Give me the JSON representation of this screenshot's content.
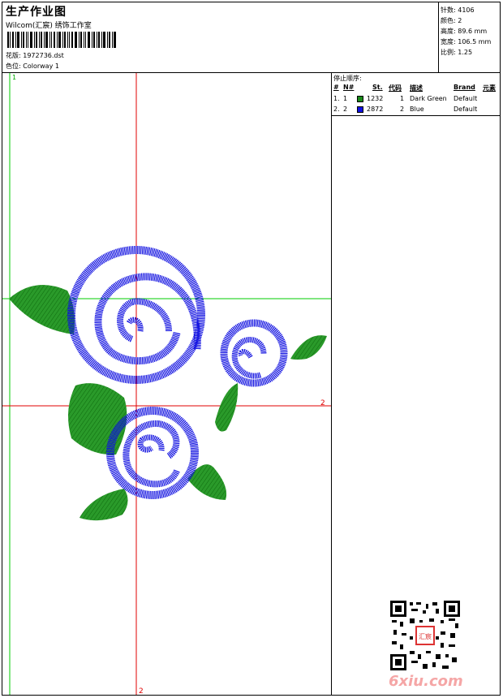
{
  "header": {
    "title": "生产作业图",
    "studio": "Wilcom(汇宸) 绣饰工作室",
    "design_label": "花版:",
    "design_file": "1972736.dst",
    "colorway_label": "色位:",
    "colorway": "Colorway 1"
  },
  "stats": {
    "stitches_label": "针数:",
    "stitches": "4106",
    "colors_label": "颜色:",
    "colors": "2",
    "height_label": "高度:",
    "height": "89.6 mm",
    "width_label": "宽度:",
    "width": "106.5 mm",
    "scale_label": "比例:",
    "scale": "1.25"
  },
  "stop_sequence": {
    "title": "停止顺序:",
    "columns": [
      "#",
      "N#",
      "St.",
      "代码",
      "描述",
      "Brand",
      "元素"
    ],
    "rows": [
      {
        "num": "1.",
        "needle": "1",
        "color": "#1a8a1a",
        "stitches": "1232",
        "code": "1",
        "desc": "Dark Green",
        "brand": "Default"
      },
      {
        "num": "2.",
        "needle": "2",
        "color": "#1010e0",
        "stitches": "2872",
        "code": "2",
        "desc": "Blue",
        "brand": "Default"
      }
    ]
  },
  "guides": {
    "v_green_label": "1",
    "h_red_label": "2",
    "v_red_label": "2",
    "green": "#00cc00",
    "red": "#e00000"
  },
  "watermark": {
    "seal": "汇宸",
    "logo": "6xiu.com"
  }
}
